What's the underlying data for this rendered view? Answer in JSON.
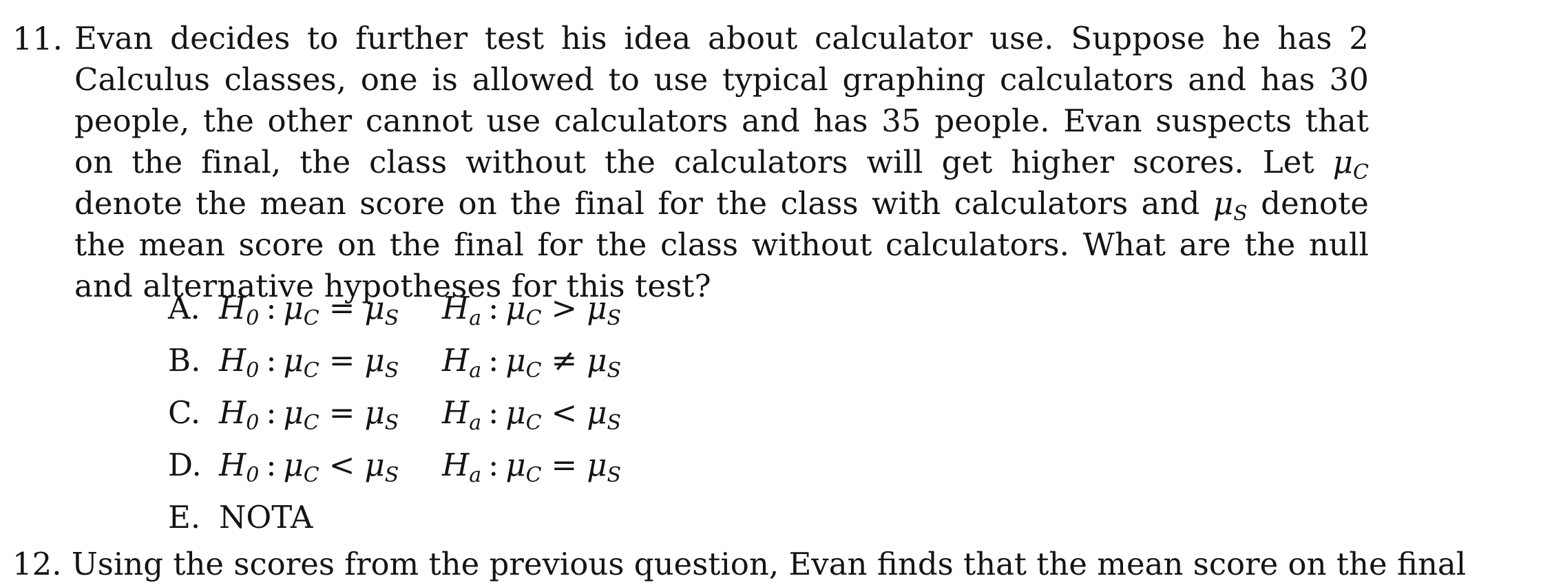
{
  "question": {
    "number": "11.",
    "line1": "Evan decides to further test his idea about calculator use. Suppose he has 2 Calculus",
    "line2": "classes, one is allowed to use typical graphing calculators and has 30 people, the other",
    "line3": "cannot use calculators and has 35 people. Evan suspects that on the final, the class",
    "line4a": "without the calculators will get higher scores. Let",
    "mu_c_symbol": "μ",
    "mu_c_sub": "C",
    "line4b": "denote the mean score on the final",
    "line5a": "for the class with calculators and",
    "mu_s_symbol": "μ",
    "mu_s_sub": "S",
    "line5b": "denote the mean score on the final for the class",
    "line6": "without calculators. What are the null and alternative hypotheses for this test?"
  },
  "options": [
    {
      "letter": "A.",
      "h0_rel": "=",
      "ha_rel": ">"
    },
    {
      "letter": "B.",
      "h0_rel": "=",
      "ha_rel": "≠"
    },
    {
      "letter": "C.",
      "h0_rel": "=",
      "ha_rel": "<"
    },
    {
      "letter": "D.",
      "h0_rel": "<",
      "ha_rel": "="
    },
    {
      "letter": "E.",
      "text": "NOTA"
    }
  ],
  "symbols": {
    "h": "H",
    "h0_sub": "0",
    "ha_sub": "a",
    "colon": ":",
    "mu": "μ",
    "c": "C",
    "s": "S"
  },
  "next_question": {
    "text": "12. Using the scores from the previous question, Evan finds that the mean score on the final"
  }
}
